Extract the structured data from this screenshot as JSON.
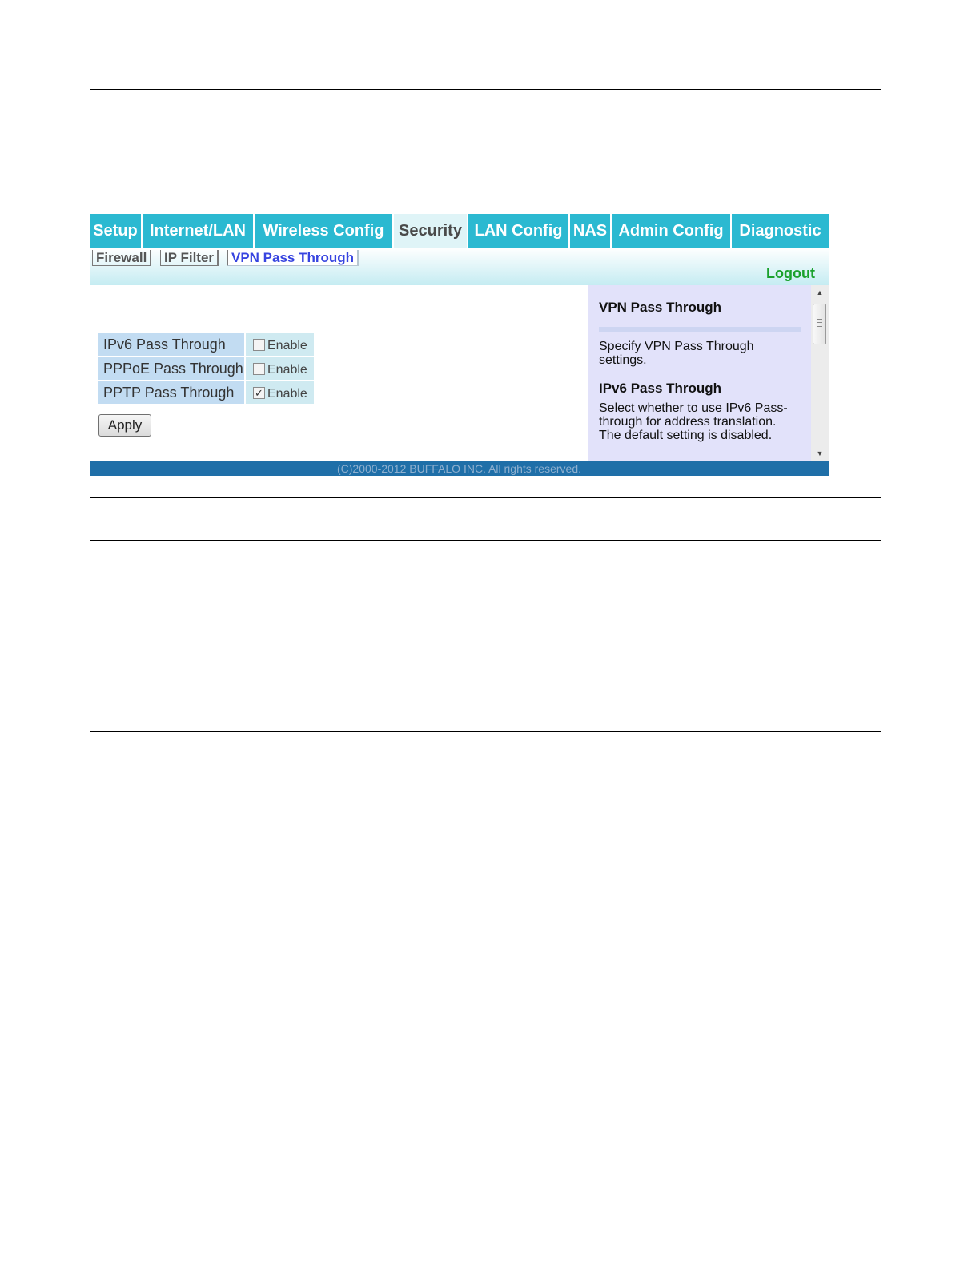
{
  "tabs": [
    {
      "label": "Setup",
      "active": false
    },
    {
      "label": "Internet/LAN",
      "active": false
    },
    {
      "label": "Wireless Config",
      "active": false
    },
    {
      "label": "Security",
      "active": true
    },
    {
      "label": "LAN Config",
      "active": false
    },
    {
      "label": "NAS",
      "active": false
    },
    {
      "label": "Admin Config",
      "active": false
    },
    {
      "label": "Diagnostic",
      "active": false
    }
  ],
  "subtabs": [
    {
      "label": "Firewall",
      "active": false
    },
    {
      "label": "IP Filter",
      "active": false
    },
    {
      "label": "VPN Pass Through",
      "active": true
    }
  ],
  "logout_label": "Logout",
  "form": {
    "rows": [
      {
        "label": "IPv6 Pass Through",
        "enable_label": "Enable",
        "checked": false
      },
      {
        "label": "PPPoE Pass Through",
        "enable_label": "Enable",
        "checked": false
      },
      {
        "label": "PPTP Pass Through",
        "enable_label": "Enable",
        "checked": true
      }
    ],
    "apply_label": "Apply"
  },
  "help": {
    "title": "VPN Pass Through",
    "intro": "Specify VPN Pass Through settings.",
    "section_title": "IPv6 Pass Through",
    "section_text": "Select whether to use IPv6 Pass-through for address translation. The default setting is disabled."
  },
  "footer": "(C)2000-2012 BUFFALO INC. All rights reserved.",
  "colors": {
    "tab_bg": "#2bb9d1",
    "tab_active_bg": "#dff4f7",
    "footer_bg": "#1f6fa8",
    "logout": "#1aa12c",
    "help_bg": "#e2e2fa"
  }
}
